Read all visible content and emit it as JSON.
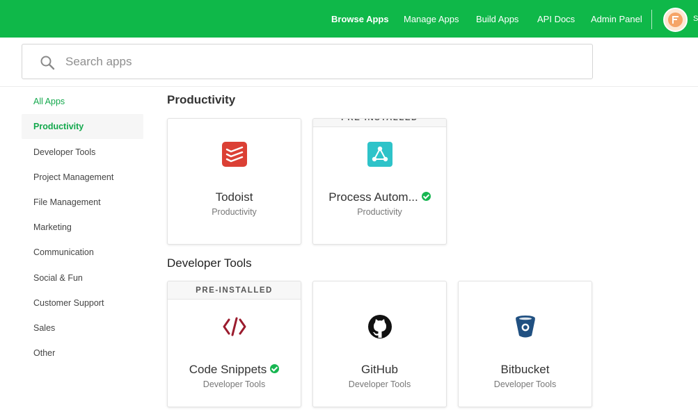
{
  "nav": {
    "links": [
      "Browse Apps",
      "Manage Apps",
      "Build Apps",
      "API Docs",
      "Admin Panel"
    ],
    "user_initial": "S"
  },
  "search": {
    "placeholder": "Search apps",
    "value": ""
  },
  "sidebar": {
    "items": [
      {
        "label": "All Apps"
      },
      {
        "label": "Productivity"
      },
      {
        "label": "Developer Tools"
      },
      {
        "label": "Project Management"
      },
      {
        "label": "File Management"
      },
      {
        "label": "Marketing"
      },
      {
        "label": "Communication"
      },
      {
        "label": "Social & Fun"
      },
      {
        "label": "Customer Support"
      },
      {
        "label": "Sales"
      },
      {
        "label": "Other"
      }
    ]
  },
  "sections": [
    {
      "title": "Productivity",
      "apps": [
        {
          "name": "Todoist",
          "category": "Productivity",
          "banner": "",
          "icon": "todoist-icon",
          "verified": false
        },
        {
          "name": "Process Autom...",
          "category": "Productivity",
          "banner": "PRE-INSTALLED",
          "icon": "process-automation-icon",
          "verified": true
        }
      ]
    },
    {
      "title": "Developer Tools",
      "apps": [
        {
          "name": "Code Snippets",
          "category": "Developer Tools",
          "banner": "PRE-INSTALLED",
          "icon": "code-snippets-icon",
          "verified": true
        },
        {
          "name": "GitHub",
          "category": "Developer Tools",
          "banner": "",
          "icon": "github-icon",
          "verified": false
        },
        {
          "name": "Bitbucket",
          "category": "Developer Tools",
          "banner": "",
          "icon": "bitbucket-icon",
          "verified": false
        }
      ]
    }
  ],
  "colors": {
    "brand_green": "#0fb849",
    "accent_green": "#13a84c",
    "todoist_red": "#db4035",
    "process_teal": "#2ec3c9",
    "code_red": "#9b1c2e",
    "bitbucket_blue": "#205081"
  }
}
